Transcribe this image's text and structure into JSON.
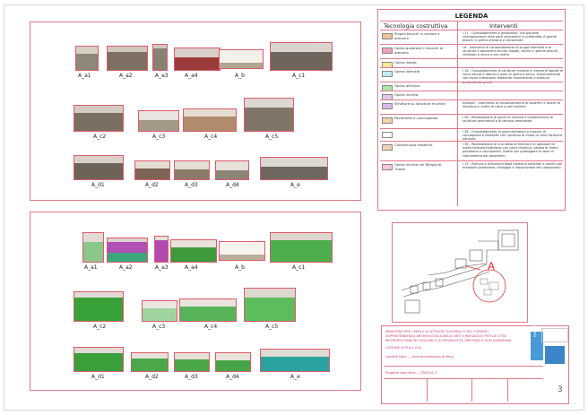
{
  "legend": {
    "title": "LEGENDA",
    "col_tech": "Tecnologia costruttiva",
    "col_interv": "Interventi",
    "rows": [
      {
        "swatch": "#f2c29a",
        "label": "Singoli blocchi in calcare o arenaria",
        "desc": "I 17 - Consolidamento e protezione, con parziale ricomposizione delle parti pericolanti in profondità di grandi blocchi in pietra arenaria e calcarenite"
      },
      {
        "swatch": "#f5a0c0",
        "label": "Opera quadrata in blocchi di arenaria",
        "desc": "I 8 - Interventi di consolidamento di singoli elementi e di strutture e paramenti murari lapidei, anche in grandi blocchi, realizzati a secco o con malta"
      },
      {
        "swatch": "#f5eb9a",
        "label": "Opera listata",
        "desc": ""
      },
      {
        "swatch": "#bfeff0",
        "label": "Opera laterizia",
        "desc": "I 16 - Consolidamento di strutture murarie in elementi lapidei di varia natura e laterizi e posti in opera a secco, eventualmente con lavori interstiziali mediante risarcimento e stilatura profonda dei giunti"
      },
      {
        "swatch": "#a8e8a8",
        "label": "Opera africana",
        "desc": ""
      },
      {
        "swatch": "#e0c8f0",
        "label": "Opera incerta",
        "desc": ""
      },
      {
        "swatch": "#d9b7ec",
        "label": "Strutture su struttura muraria",
        "desc": "Indagini - intervento di consolidamento di superfici e lacerti di intonaco in malta di calce e pali sintetici"
      },
      {
        "swatch": "#f3d2a8",
        "label": "Pavimento in cocciopesto",
        "desc": "I 56 - Realizzazione di opere di rinforzo e contenimento di strutture perimetrali e di terrazzi ammorsati"
      },
      {
        "swatch": "#ffffff",
        "label": "",
        "desc": "I 36 - Consolidamento di pavimentazioni a mosaici di cocciopesto e tessellati con ripristino di malta di calce idraulica naturale"
      },
      {
        "swatch": "#f2d0b8",
        "label": "Calcestruzzo moderno",
        "desc": "I 38 - Realizzazione di una stesa di finitura e in spessore di malta formata tradizione con calce idraulica, sabbia di fiume, pozzolana e cocciopesto, inoltre per proteggere le zone di risanamento dei paramenti"
      },
      {
        "swatch": "#f5c9d8",
        "label": "Opera incerta nel Tempio di Thanit",
        "desc": "I 19 - Pulitura e rilievatura degli elementi lamellari e lacerti vari mediante protezione, tinteggio e rilavorazione dei componenti"
      }
    ]
  },
  "top_panel": {
    "labels": [
      "A_a1",
      "A_a2",
      "A_a3",
      "A_a4",
      "A_b",
      "A_c1",
      "A_c2",
      "A_c3",
      "A_c4",
      "A_c5",
      "A_d1",
      "A_d2",
      "A_d3",
      "A_d4",
      "A_e"
    ]
  },
  "bottom_panel": {
    "labels": [
      "A_a1",
      "A_a2",
      "A_a3",
      "A_a4",
      "A_b",
      "A_c1",
      "A_c2",
      "A_c3",
      "A_c4",
      "A_c5",
      "A_d1",
      "A_d2",
      "A_d3",
      "A_d4",
      "A_e"
    ]
  },
  "map": {
    "marker": "A"
  },
  "titleblock": {
    "line1": "MINISTERO PER I BENI E LE ATTIVITÀ CULTURALI E DEL TURISMO",
    "line2": "SOPRINTENDENZA ARCHEOLOGICA BELLE ARTI E PAESAGGIO PER LA CITTÀ",
    "line3": "METROPOLITANA DI CAGLIARI E LE PROVINCE DI ORISTANO E SUD SARDEGNA",
    "line4": "COMUNE DI PULA (CA)",
    "line5": "Località Nora — Area archeologica di Nora",
    "line6": "Progetto esecutivo — TAVOLA 3",
    "sheet_number": "3",
    "logo_text": "MiBACT"
  }
}
